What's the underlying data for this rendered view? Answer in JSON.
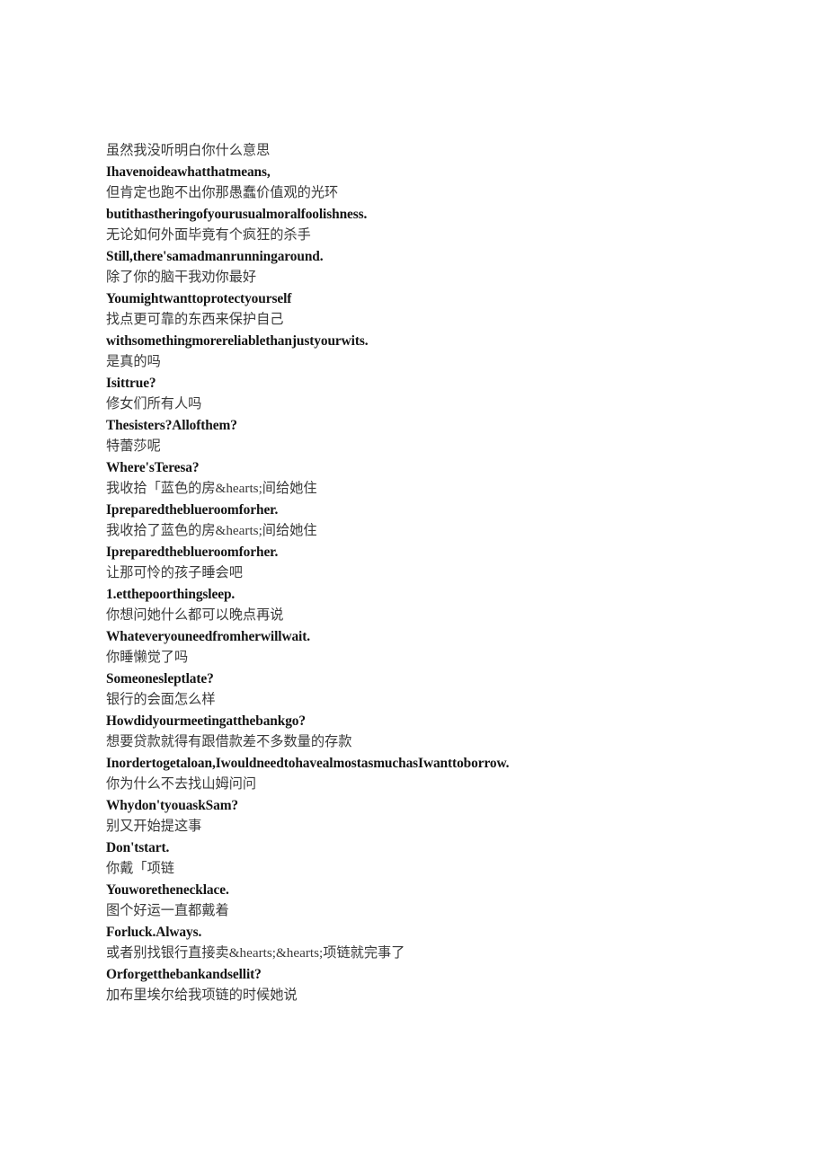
{
  "document": {
    "type": "bilingual-subtitle-transcript",
    "background_color": "#ffffff",
    "zh_text_color": "#3a3a3a",
    "en_text_color": "#141414",
    "lines": [
      {
        "lang": "zh",
        "text": "虽然我没听明白你什么意思"
      },
      {
        "lang": "en",
        "text": "Ihavenoideawhatthatmeans,"
      },
      {
        "lang": "zh",
        "text": "但肯定也跑不出你那愚蠢价值观的光环"
      },
      {
        "lang": "en",
        "text": "butithastheringofyourusualmoralfoolishness."
      },
      {
        "lang": "zh",
        "text": "无论如何外面毕竟有个疯狂的杀手"
      },
      {
        "lang": "en",
        "text": "Still,there'samadmanrunningaround."
      },
      {
        "lang": "zh",
        "text": "除了你的脑干我劝你最好"
      },
      {
        "lang": "en",
        "text": "Youmightwanttoprotectyourself"
      },
      {
        "lang": "zh",
        "text": "找点更可靠的东西来保护自己"
      },
      {
        "lang": "en",
        "text": "withsomethingmorereliablethanjustyourwits."
      },
      {
        "lang": "zh",
        "text": "是真的吗"
      },
      {
        "lang": "en",
        "text": "Isittrue?"
      },
      {
        "lang": "zh",
        "text": "修女们所有人吗"
      },
      {
        "lang": "en",
        "text": "Thesisters?Allofthem?"
      },
      {
        "lang": "zh",
        "text": "特蕾莎呢"
      },
      {
        "lang": "en",
        "text": "Where'sTeresa?"
      },
      {
        "lang": "zh",
        "text": "我收拾「蓝色的房&hearts;间给她住"
      },
      {
        "lang": "en",
        "text": "Ipreparedtheblueroomforher."
      },
      {
        "lang": "zh",
        "text": "我收拾了蓝色的房&hearts;间给她住"
      },
      {
        "lang": "en",
        "text": "Ipreparedtheblueroomforher."
      },
      {
        "lang": "zh",
        "text": "让那可怜的孩子睡会吧"
      },
      {
        "lang": "en",
        "text": "1.etthepoorthingsleep."
      },
      {
        "lang": "zh",
        "text": "你想问她什么都可以晚点再说"
      },
      {
        "lang": "en",
        "text": "Whateveryouneedfromherwillwait."
      },
      {
        "lang": "zh",
        "text": "你睡懒觉了吗"
      },
      {
        "lang": "en",
        "text": "Someonesleptlate?"
      },
      {
        "lang": "zh",
        "text": "银行的会面怎么样"
      },
      {
        "lang": "en",
        "text": "Howdidyourmeetingatthebankgo?"
      },
      {
        "lang": "zh",
        "text": "想要贷款就得有跟借款差不多数量的存款"
      },
      {
        "lang": "en",
        "text": "Inordertogetaloan,IwouldneedtohavealmostasmuchasIwanttoborrow."
      },
      {
        "lang": "zh",
        "text": "你为什么不去找山姆问问"
      },
      {
        "lang": "en",
        "text": "Whydon'tyouaskSam?"
      },
      {
        "lang": "zh",
        "text": "别又开始提这事"
      },
      {
        "lang": "en",
        "text": "Don'tstart."
      },
      {
        "lang": "zh",
        "text": "你戴「项链"
      },
      {
        "lang": "en",
        "text": "Youworethenecklace."
      },
      {
        "lang": "zh",
        "text": "图个好运一直都戴着"
      },
      {
        "lang": "en",
        "text": "Forluck.Always."
      },
      {
        "lang": "zh",
        "text": "或者别找银行直接卖&hearts;&hearts;项链就完事了"
      },
      {
        "lang": "en",
        "text": "Orforgetthebankandsellit?"
      },
      {
        "lang": "zh",
        "text": "加布里埃尔给我项链的时候她说"
      }
    ]
  }
}
